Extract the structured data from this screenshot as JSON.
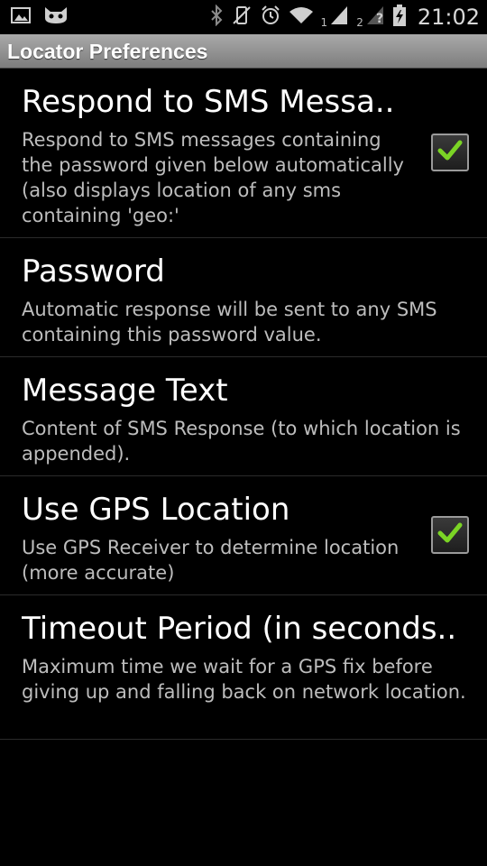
{
  "status_bar": {
    "time": "21:02",
    "sim1": "1",
    "sim2": "2",
    "icons": [
      "picture-icon",
      "cyanogen-icon",
      "bluetooth-icon",
      "vibrate-off-icon",
      "alarm-icon",
      "wifi-icon",
      "signal-icon",
      "signal-unknown-icon",
      "battery-charging-icon"
    ]
  },
  "title": "Locator Preferences",
  "accent_color": "#7bd425",
  "preferences": [
    {
      "title": "Respond to SMS Messa..",
      "summary": "Respond to SMS messages containing the password given below automatically (also displays location of any sms containing 'geo:'",
      "checked": true
    },
    {
      "title": "Password",
      "summary": "Automatic response will be sent to any SMS containing this password value."
    },
    {
      "title": "Message Text",
      "summary": "Content of SMS Response (to which location is appended)."
    },
    {
      "title": "Use GPS Location",
      "summary": "Use GPS Receiver to determine location (more accurate)",
      "checked": true
    },
    {
      "title": "Timeout Period (in seconds..",
      "summary": "Maximum time we wait for a GPS fix before giving up and falling back on network location."
    }
  ]
}
